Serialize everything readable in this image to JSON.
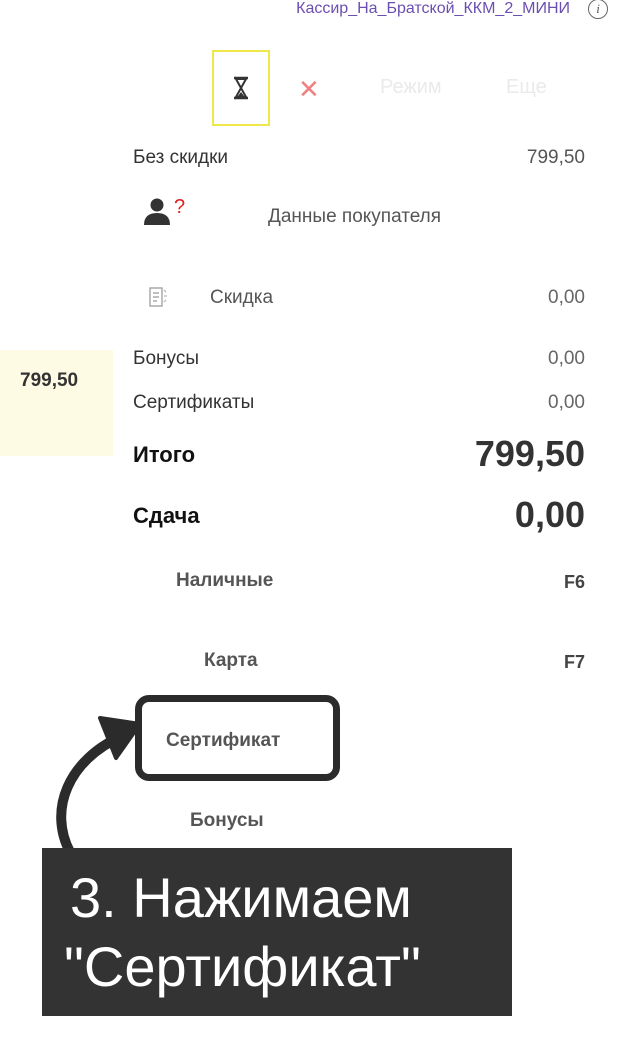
{
  "header": {
    "cashier_name": "Кассир_На_Братской_ККМ_2_МИНИ",
    "info_icon_glyph": "i"
  },
  "toolbar": {
    "cancel_glyph": "✕",
    "mode_label": "Режим",
    "more_label": "Еще"
  },
  "summary": {
    "no_discount_label": "Без скидки",
    "no_discount_value": "799,50",
    "customer_label": "Данные покупателя",
    "customer_unknown_mark": "?",
    "discount_label": "Скидка",
    "discount_value": "0,00",
    "bonuses_label": "Бонусы",
    "bonuses_value": "0,00",
    "certificates_label": "Сертификаты",
    "certificates_value": "0,00",
    "total_label": "Итого",
    "total_value": "799,50",
    "change_label": "Сдача",
    "change_value": "0,00"
  },
  "entered_amount": "799,50",
  "payments": [
    {
      "label": "Наличные",
      "key": "F6"
    },
    {
      "label": "Карта",
      "key": "F7"
    },
    {
      "label": "Сертификат",
      "key": ""
    },
    {
      "label": "Бонусы",
      "key": ""
    }
  ],
  "annotation": {
    "line1": "3. Нажимаем",
    "line2": "\"Сертификат\"",
    "box_color": "#333333",
    "highlight_color": "#2b2b2b"
  },
  "colors": {
    "cashier_text": "#6b4fb0",
    "hourglass_border": "#f0e84a",
    "cancel": "#f08080",
    "amount_bg": "#fdfbe3"
  }
}
